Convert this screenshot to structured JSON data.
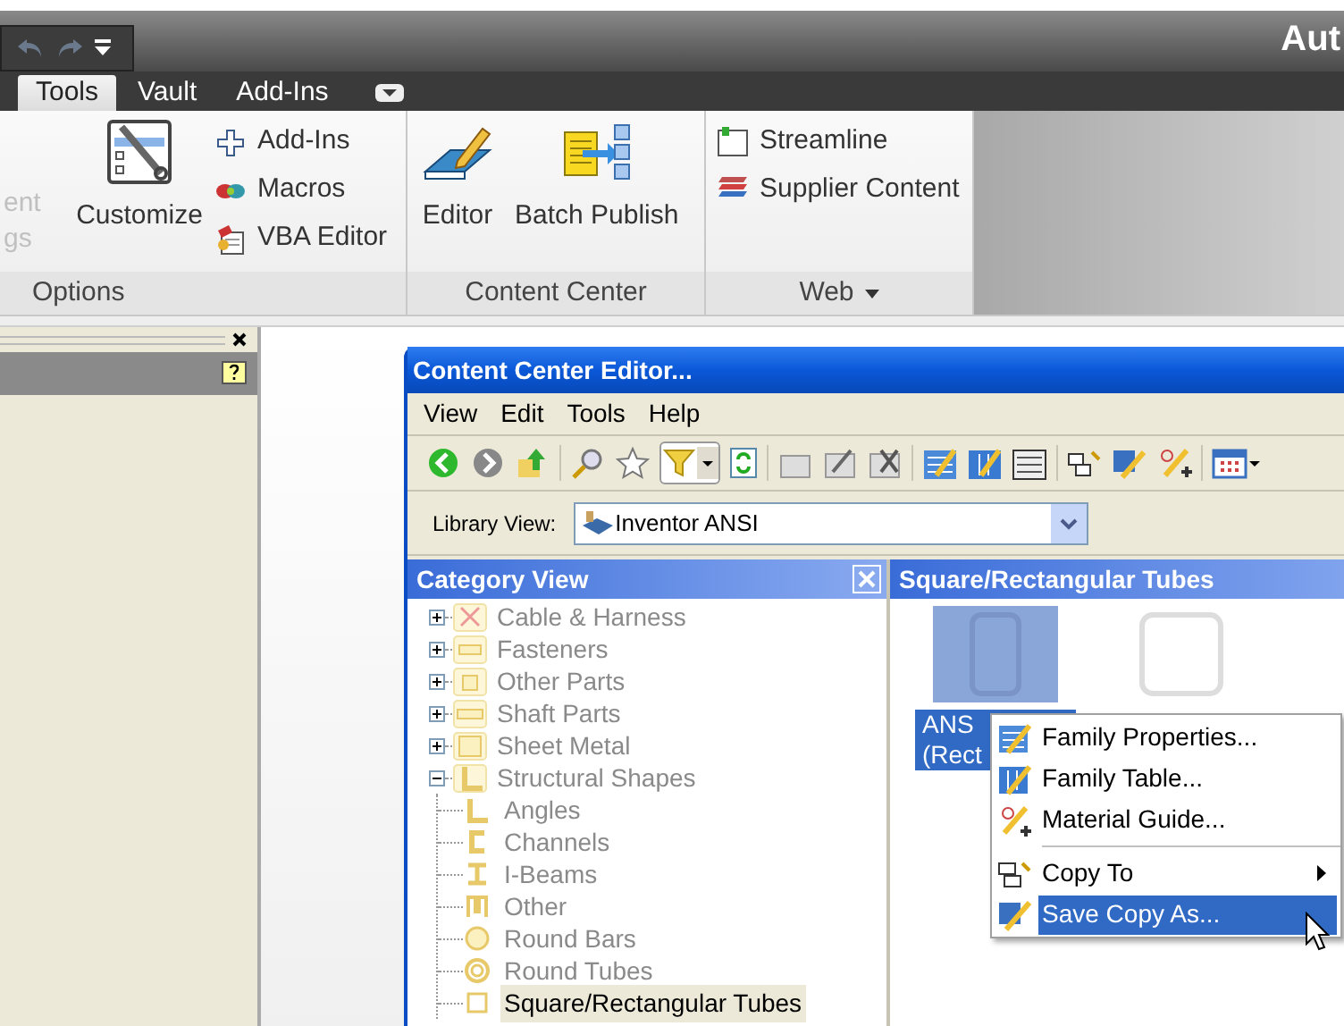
{
  "app_title": "Aut",
  "ribbon_tabs": [
    {
      "label": "Tools",
      "selected": true
    },
    {
      "label": "Vault",
      "selected": false
    },
    {
      "label": "Add-Ins",
      "selected": false
    }
  ],
  "options_panel": {
    "label": "Options",
    "faded_lines": [
      "ent",
      "gs"
    ],
    "large_button": "Customize",
    "small_buttons": [
      "Add-Ins",
      "Macros",
      "VBA Editor"
    ]
  },
  "content_center_panel": {
    "label": "Content Center",
    "large_buttons": [
      "Editor",
      "Batch Publish"
    ]
  },
  "web_panel": {
    "label": "Web",
    "has_menu": true,
    "small_buttons": [
      "Streamline",
      "Supplier Content"
    ]
  },
  "editor": {
    "title": "Content Center Editor...",
    "menu": [
      "View",
      "Edit",
      "Tools",
      "Help"
    ],
    "library_label": "Library View:",
    "library_value": "Inventor ANSI",
    "category_title": "Category View",
    "tree": [
      {
        "label": "Cable & Harness",
        "expanded": false,
        "selected": false
      },
      {
        "label": "Fasteners",
        "expanded": false,
        "selected": false
      },
      {
        "label": "Other Parts",
        "expanded": false,
        "selected": false
      },
      {
        "label": "Shaft Parts",
        "expanded": false,
        "selected": false
      },
      {
        "label": "Sheet Metal",
        "expanded": false,
        "selected": false
      },
      {
        "label": "Structural Shapes",
        "expanded": true,
        "selected": false,
        "children": [
          {
            "label": "Angles",
            "selected": false
          },
          {
            "label": "Channels",
            "selected": false
          },
          {
            "label": "I-Beams",
            "selected": false
          },
          {
            "label": "Other",
            "selected": false
          },
          {
            "label": "Round Bars",
            "selected": false
          },
          {
            "label": "Round Tubes",
            "selected": false
          },
          {
            "label": "Square/Rectangular Tubes",
            "selected": true
          }
        ]
      }
    ],
    "family_title": "Square/Rectangular Tubes",
    "families": [
      {
        "label_lines": [
          "ANS",
          "(Rect"
        ],
        "selected": true
      },
      {
        "selected": false
      }
    ],
    "context_menu": [
      {
        "kind": "item",
        "label": "Family Properties...",
        "submenu": false,
        "selected": false
      },
      {
        "kind": "item",
        "label": "Family Table...",
        "submenu": false,
        "selected": false
      },
      {
        "kind": "item",
        "label": "Material Guide...",
        "submenu": false,
        "selected": false
      },
      {
        "kind": "separator"
      },
      {
        "kind": "item",
        "label": "Copy To",
        "submenu": true,
        "selected": false
      },
      {
        "kind": "item",
        "label": "Save Copy As...",
        "submenu": false,
        "selected": true
      }
    ]
  }
}
